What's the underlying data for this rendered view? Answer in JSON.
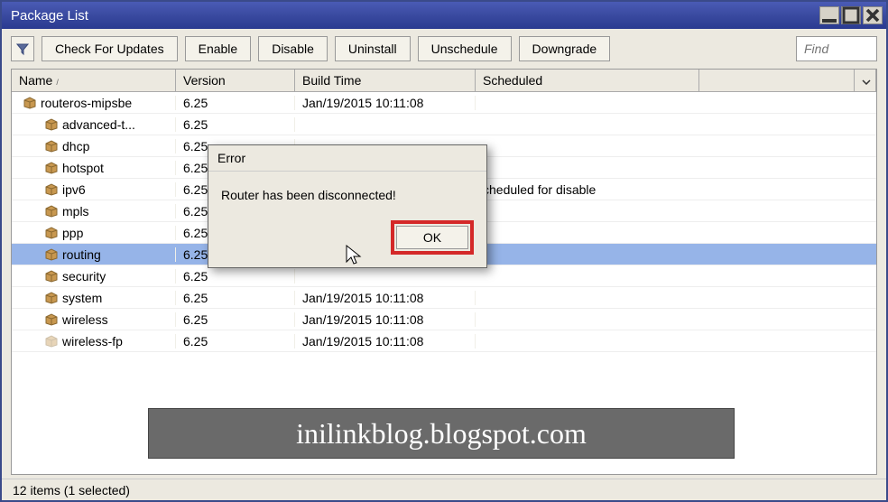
{
  "window": {
    "title": "Package List"
  },
  "toolbar": {
    "check_updates": "Check For Updates",
    "enable": "Enable",
    "disable": "Disable",
    "uninstall": "Uninstall",
    "unschedule": "Unschedule",
    "downgrade": "Downgrade",
    "find_placeholder": "Find"
  },
  "columns": {
    "name": "Name",
    "version": "Version",
    "build": "Build Time",
    "scheduled": "Scheduled"
  },
  "rows": [
    {
      "indent": 0,
      "name": "routeros-mipsbe",
      "version": "6.25",
      "build": "Jan/19/2015 10:11:08",
      "scheduled": "",
      "disabled": false
    },
    {
      "indent": 1,
      "name": "advanced-t...",
      "version": "6.25",
      "build": "",
      "scheduled": "",
      "disabled": false
    },
    {
      "indent": 1,
      "name": "dhcp",
      "version": "6.25",
      "build": "",
      "scheduled": "",
      "disabled": false
    },
    {
      "indent": 1,
      "name": "hotspot",
      "version": "6.25",
      "build": "",
      "scheduled": "",
      "disabled": false
    },
    {
      "indent": 1,
      "name": "ipv6",
      "version": "6.25",
      "build": "",
      "scheduled": "cheduled for disable",
      "disabled": false
    },
    {
      "indent": 1,
      "name": "mpls",
      "version": "6.25",
      "build": "",
      "scheduled": "",
      "disabled": false
    },
    {
      "indent": 1,
      "name": "ppp",
      "version": "6.25",
      "build": "",
      "scheduled": "",
      "disabled": false
    },
    {
      "indent": 1,
      "name": "routing",
      "version": "6.25",
      "build": "",
      "scheduled": "",
      "disabled": false,
      "selected": true
    },
    {
      "indent": 1,
      "name": "security",
      "version": "6.25",
      "build": "",
      "scheduled": "",
      "disabled": false
    },
    {
      "indent": 1,
      "name": "system",
      "version": "6.25",
      "build": "Jan/19/2015 10:11:08",
      "scheduled": "",
      "disabled": false
    },
    {
      "indent": 1,
      "name": "wireless",
      "version": "6.25",
      "build": "Jan/19/2015 10:11:08",
      "scheduled": "",
      "disabled": false
    },
    {
      "indent": 1,
      "name": "wireless-fp",
      "version": "6.25",
      "build": "Jan/19/2015 10:11:08",
      "scheduled": "",
      "disabled": true
    }
  ],
  "status": "12 items (1 selected)",
  "dialog": {
    "title": "Error",
    "message": "Router has been disconnected!",
    "ok": "OK"
  },
  "watermark": "inilinkblog.blogspot.com"
}
